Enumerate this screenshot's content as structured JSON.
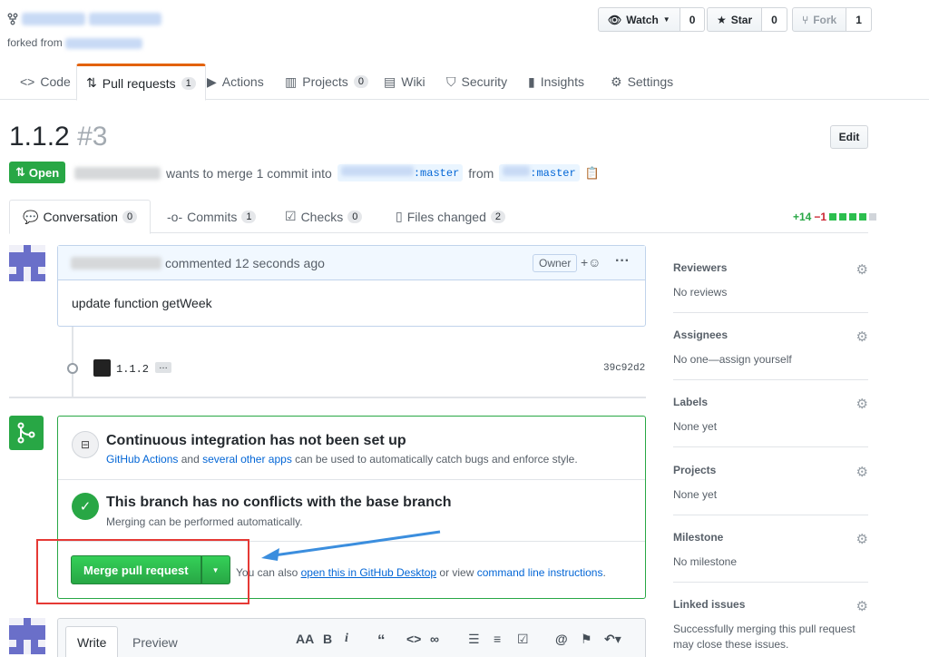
{
  "repo": {
    "forked_from_label": "forked from"
  },
  "actions": {
    "watch": {
      "label": "Watch",
      "count": "0"
    },
    "star": {
      "label": "Star",
      "count": "0"
    },
    "fork": {
      "label": "Fork",
      "count": "1"
    }
  },
  "nav": [
    {
      "label": "Code"
    },
    {
      "label": "Pull requests",
      "count": "1"
    },
    {
      "label": "Actions"
    },
    {
      "label": "Projects",
      "count": "0"
    },
    {
      "label": "Wiki"
    },
    {
      "label": "Security"
    },
    {
      "label": "Insights"
    },
    {
      "label": "Settings"
    }
  ],
  "pr": {
    "title": "1.1.2",
    "number": "#3",
    "state": "Open",
    "meta_text": "wants to merge 1 commit into",
    "base_branch_suffix": ":master",
    "from_label": "from",
    "head_branch": ":master",
    "edit_label": "Edit"
  },
  "tabs": [
    {
      "label": "Conversation",
      "count": "0"
    },
    {
      "label": "Commits",
      "count": "1"
    },
    {
      "label": "Checks",
      "count": "0"
    },
    {
      "label": "Files changed",
      "count": "2"
    }
  ],
  "diffstat": {
    "add": "+14",
    "del": "−1"
  },
  "comment": {
    "action": "commented 12 seconds ago",
    "badge": "Owner",
    "body": "update function getWeek"
  },
  "commit": {
    "message": "1.1.2",
    "ellipsis": "…",
    "sha": "39c92d2"
  },
  "merge": {
    "ci_title": "Continuous integration has not been set up",
    "ci_link1": "GitHub Actions",
    "ci_and": "and",
    "ci_link2": "several other apps",
    "ci_tail": "can be used to automatically catch bugs and enforce style.",
    "conflict_title": "This branch has no conflicts with the base branch",
    "conflict_sub": "Merging can be performed automatically.",
    "button": "Merge pull request",
    "also_text": "You can also",
    "desktop_link": "open this in GitHub Desktop",
    "or_view": "or view",
    "cli_link": "command line instructions",
    "period": "."
  },
  "sidebar": [
    {
      "title": "Reviewers",
      "value": "No reviews"
    },
    {
      "title": "Assignees",
      "value": "No one—assign yourself"
    },
    {
      "title": "Labels",
      "value": "None yet"
    },
    {
      "title": "Projects",
      "value": "None yet"
    },
    {
      "title": "Milestone",
      "value": "No milestone"
    },
    {
      "title": "Linked issues",
      "value": "Successfully merging this pull request may close these issues."
    }
  ],
  "editor": {
    "write": "Write",
    "preview": "Preview"
  },
  "colors": {
    "green": "#28a745",
    "blue": "#0366d6",
    "annotation_red": "#e53935",
    "arrow_blue": "#3b8ede"
  }
}
